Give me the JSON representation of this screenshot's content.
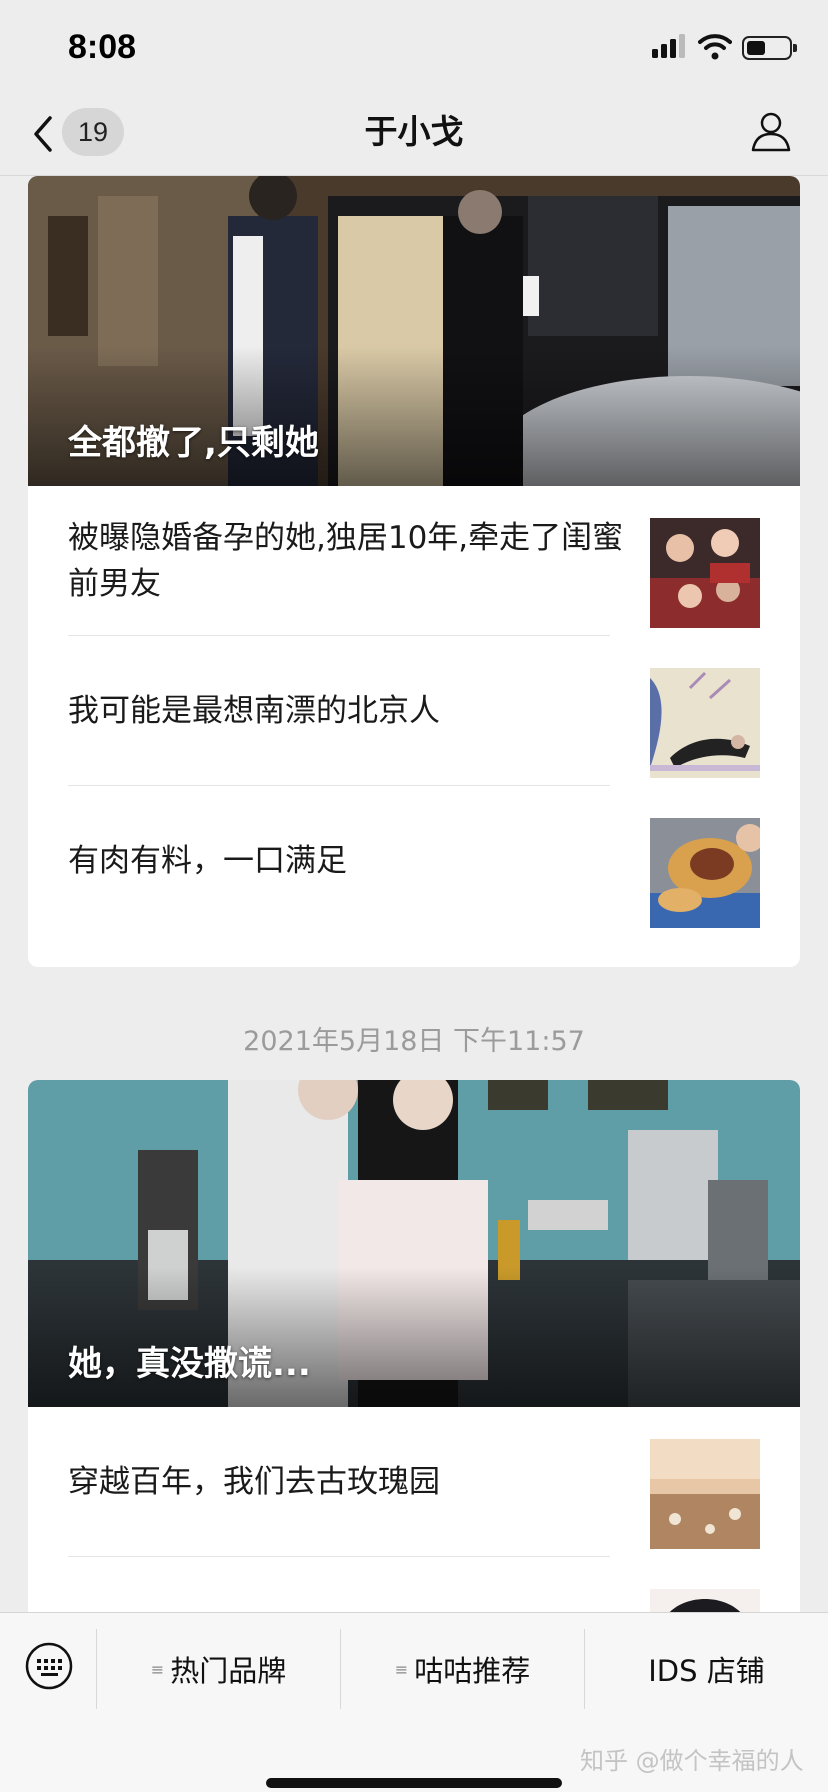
{
  "status_bar": {
    "time": "8:08"
  },
  "nav": {
    "back_count": "19",
    "title": "于小戈"
  },
  "feed": {
    "group1": {
      "hero_title": "全都撤了,只剩她",
      "items": [
        {
          "title": "被曝隐婚备孕的她,独居10年,牵走了闺蜜前男友"
        },
        {
          "title": "我可能是最想南漂的北京人"
        },
        {
          "title": "有肉有料，一口满足"
        }
      ]
    },
    "timestamp": "2021年5月18日 下午11:57",
    "group2": {
      "hero_title": "她，真没撒谎...",
      "items": [
        {
          "title": "穿越百年，我们去古玫瑰园"
        }
      ]
    }
  },
  "menu": {
    "items": [
      {
        "label": "热门品牌"
      },
      {
        "label": "咕咕推荐"
      },
      {
        "label": "IDS 店铺"
      }
    ]
  },
  "watermark": "知乎 @做个幸福的人"
}
